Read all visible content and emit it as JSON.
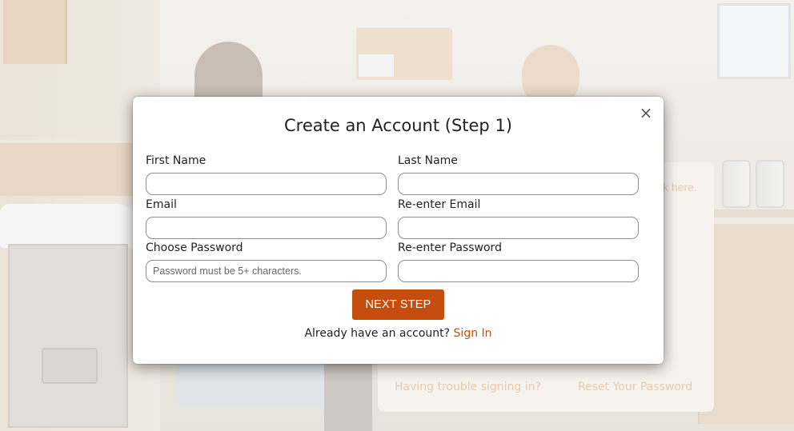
{
  "modal": {
    "title": "Create an Account (Step 1)",
    "close_symbol": "×",
    "fields": {
      "first_name": {
        "label": "First Name",
        "value": "",
        "placeholder": ""
      },
      "last_name": {
        "label": "Last Name",
        "value": "",
        "placeholder": ""
      },
      "email": {
        "label": "Email",
        "value": "",
        "placeholder": ""
      },
      "reenter_email": {
        "label": "Re-enter Email",
        "value": "",
        "placeholder": ""
      },
      "choose_password": {
        "label": "Choose Password",
        "value": "",
        "placeholder": "Password must be 5+ characters."
      },
      "reenter_password": {
        "label": "Re-enter Password",
        "value": "",
        "placeholder": ""
      }
    },
    "next_button_label": "NEXT STEP",
    "signin_prompt": "Already have an account?",
    "signin_link": "Sign In"
  },
  "background_login": {
    "partial_text": "k here.",
    "trouble_link": "Having trouble signing in?",
    "reset_link": "Reset Your Password"
  },
  "colors": {
    "accent": "#c54e0e",
    "faded_link": "#ebc7a6"
  }
}
